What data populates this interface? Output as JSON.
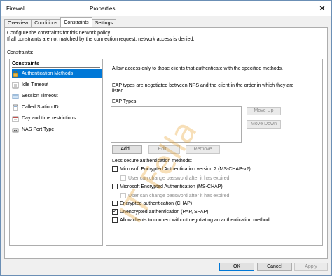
{
  "titlebar": {
    "left": "Firewall",
    "center": "Properties",
    "close": "✕"
  },
  "tabs": [
    "Overview",
    "Conditions",
    "Constraints",
    "Settings"
  ],
  "intro": {
    "line1": "Configure the constraints for this network policy.",
    "line2": "If all constraints are not matched by the connection request, network access is denied."
  },
  "constraints_label": "Constraints:",
  "list": {
    "header": "Constraints",
    "items": [
      "Authentication Methods",
      "Idle Timeout",
      "Session Timeout",
      "Called Station ID",
      "Day and time restrictions",
      "NAS Port Type"
    ]
  },
  "right": {
    "allow_text": "Allow access only to those clients that authenticate with the specified methods.",
    "eap_note_1": "EAP types are negotiated between NPS and the client in the order in which they are",
    "eap_note_2": "listed.",
    "eap_types_label": "EAP Types:",
    "move_up": "Move Up",
    "move_down": "Move Down",
    "add": "Add...",
    "edit": "Edit...",
    "remove": "Remove",
    "less_secure": "Less secure authentication methods:",
    "checkboxes": [
      {
        "label": "Microsoft Encrypted Authentication version 2 (MS-CHAP-v2)",
        "checked": false,
        "disabled": false
      },
      {
        "label": "User can change password after it has expired",
        "checked": false,
        "disabled": true
      },
      {
        "label": "Microsoft Encrypted Authentication (MS-CHAP)",
        "checked": false,
        "disabled": false
      },
      {
        "label": "User can change password after it has expired",
        "checked": false,
        "disabled": true
      },
      {
        "label": "Encrypted authentication (CHAP)",
        "checked": false,
        "disabled": false
      },
      {
        "label": "Unencrypted authentication (PAP, SPAP)",
        "checked": true,
        "disabled": false
      },
      {
        "label": "Allow clients to connect without negotiating an authentication method",
        "checked": false,
        "disabled": false
      }
    ]
  },
  "footer": {
    "ok": "OK",
    "cancel": "Cancel",
    "apply": "Apply"
  },
  "watermark": "IT Fella"
}
